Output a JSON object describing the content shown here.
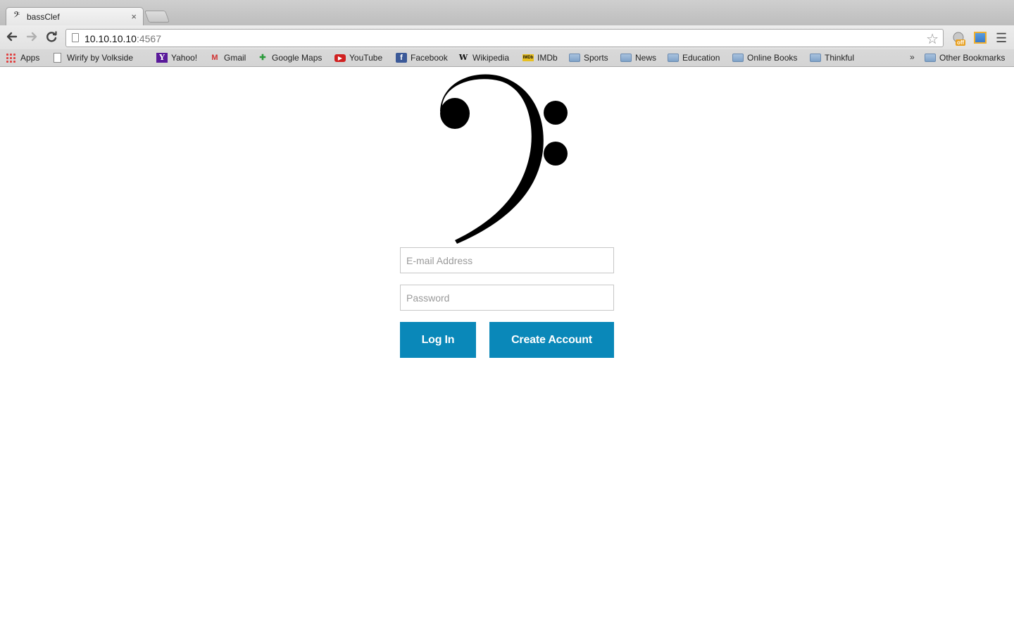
{
  "browser": {
    "tab": {
      "title": "bassClef",
      "icon": "bass-clef-icon",
      "close_glyph": "×"
    },
    "address_bar": {
      "host": "10.10.10.10",
      "port": ":4567"
    },
    "bookmarks": [
      {
        "label": "Apps",
        "icon": "apps-grid-icon"
      },
      {
        "label": "Wirify by Volkside",
        "icon": "page-icon"
      },
      {
        "label": "Yahoo!",
        "icon": "yahoo-icon"
      },
      {
        "label": "Gmail",
        "icon": "gmail-icon"
      },
      {
        "label": "Google Maps",
        "icon": "google-maps-icon"
      },
      {
        "label": "YouTube",
        "icon": "youtube-icon"
      },
      {
        "label": "Facebook",
        "icon": "facebook-icon"
      },
      {
        "label": "Wikipedia",
        "icon": "wikipedia-icon"
      },
      {
        "label": "IMDb",
        "icon": "imdb-icon"
      },
      {
        "label": "Sports",
        "icon": "folder-icon"
      },
      {
        "label": "News",
        "icon": "folder-icon"
      },
      {
        "label": "Education",
        "icon": "folder-icon"
      },
      {
        "label": "Online Books",
        "icon": "folder-icon"
      },
      {
        "label": "Thinkful",
        "icon": "folder-icon"
      }
    ],
    "bookmarks_overflow": "»",
    "other_bookmarks": "Other Bookmarks",
    "extension_badge": "off"
  },
  "login": {
    "logo": "bass-clef-logo",
    "email_placeholder": "E-mail Address",
    "password_placeholder": "Password",
    "login_label": "Log In",
    "create_account_label": "Create Account"
  },
  "colors": {
    "button_bg": "#0a88b9",
    "button_text": "#ffffff",
    "field_border": "#c7c7c7",
    "logo": "#000000"
  }
}
